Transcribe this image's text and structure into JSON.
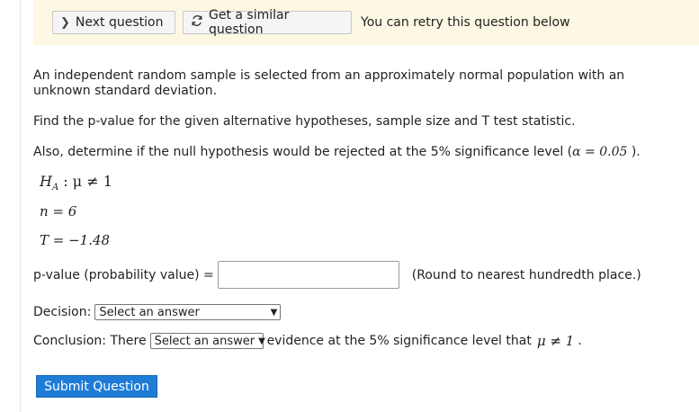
{
  "banner": {
    "next_label": "Next question",
    "similar_label": "Get a similar question",
    "retry_text": "You can retry this question below"
  },
  "question": {
    "intro": "An independent random sample is selected from an approximately normal population with an unknown standard deviation.",
    "find": "Find the p-value for the given alternative hypotheses, sample size and T test statistic.",
    "also_prefix": "Also, determine if the null hypothesis would be rejected at the 5% significance level (",
    "alpha_expr": "α = 0.05",
    "also_suffix": " ).",
    "ha_expr": "H",
    "ha_sub": "A",
    "ha_rest": " : μ ≠ 1",
    "n_expr": "n = 6",
    "t_expr": "T = −1.48"
  },
  "answer": {
    "pvalue_label": "p-value (probability value) =",
    "pvalue_value": "",
    "round_note": "(Round to nearest hundredth place.)",
    "decision_label": "Decision:",
    "decision_selected": "Select an answer",
    "conclusion_prefix": "Conclusion: There",
    "conclusion_selected": "Select an answer",
    "conclusion_suffix": "evidence at the 5% significance level that",
    "conclusion_math": "μ ≠ 1",
    "conclusion_end": "."
  },
  "submit_label": "Submit Question",
  "colors": {
    "banner_bg": "#fcf8e3",
    "submit_bg": "#1f7cd6"
  }
}
